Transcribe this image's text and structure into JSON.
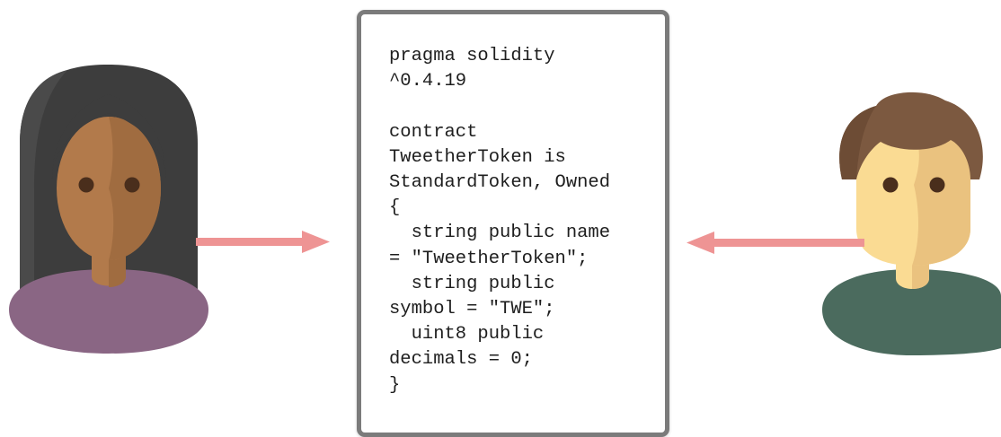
{
  "diagram": {
    "code_lines": [
      "pragma solidity",
      "^0.4.19",
      "",
      "contract",
      "TweetherToken is",
      "StandardToken, Owned",
      "{",
      "  string public name",
      "= \"TweetherToken\";",
      "  string public",
      "symbol = \"TWE\";",
      "  uint8 public",
      "decimals = 0;",
      "}"
    ],
    "colors": {
      "arrow": "#ee9494",
      "card_border": "#7b7b7b",
      "left_person_hair": "#3d3d3d",
      "left_person_skin": "#b27a4b",
      "left_person_shirt": "#8a6684",
      "right_person_hair": "#7c5940",
      "right_person_skin": "#fadb93",
      "right_person_shirt": "#4b6b5e"
    },
    "icons": [
      "woman-avatar-icon",
      "man-avatar-icon",
      "arrow-right-icon",
      "arrow-left-icon"
    ]
  }
}
